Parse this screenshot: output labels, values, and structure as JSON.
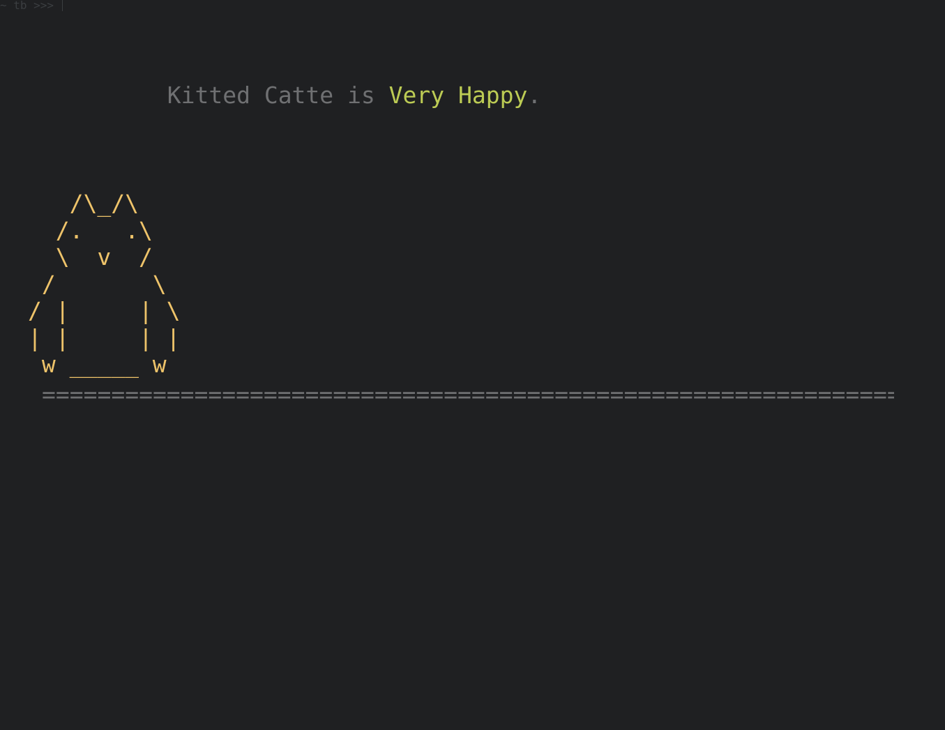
{
  "terminal": {
    "prompt": "~ tb >>>"
  },
  "status": {
    "name": "Kitted Catte",
    "verb": "is",
    "mood": "Very Happy",
    "punctuation": "."
  },
  "cat_art": {
    "lines": "   /\\_/\\\n  /.   .\\\n  \\  v  /\n /       \\\n/ |     | \\\n| |     | |\n w _____ w"
  },
  "ground": {
    "line": "=============================================================="
  },
  "colors": {
    "background": "#1f2022",
    "text_dim": "#6f7072",
    "mood": "#bccb54",
    "cat": "#eec36a",
    "prompt": "#3b3e41"
  }
}
